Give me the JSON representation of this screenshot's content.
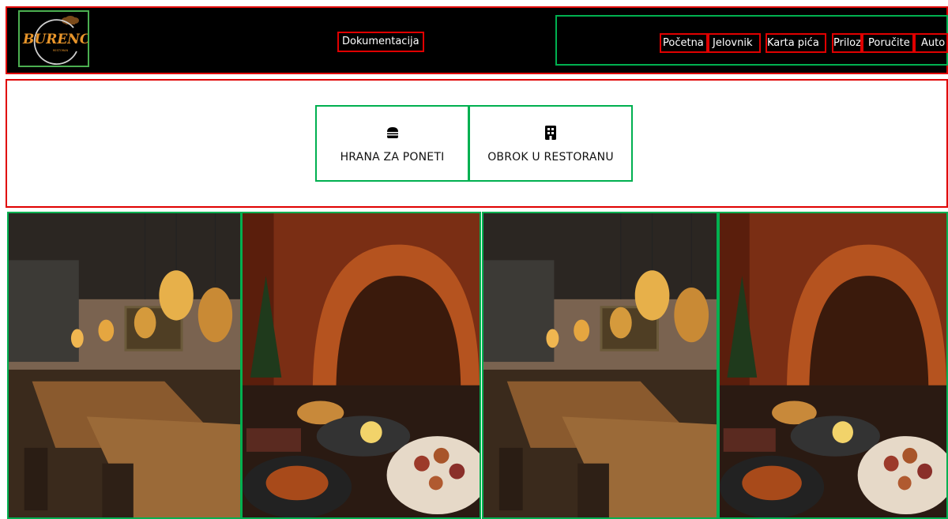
{
  "header": {
    "logo_text": "BURENCE",
    "doc_link": "Dokumentacija",
    "nav": [
      "Početna",
      "Jelovnik",
      "Karta pića",
      "Prilozi",
      "Poručite",
      "Auto"
    ]
  },
  "order_options": [
    {
      "label": "HRANA ZA PONETI",
      "icon": "burger-icon"
    },
    {
      "label": "OBROK U RESTORANU",
      "icon": "building-icon"
    }
  ],
  "gallery": [
    {
      "kind": "restaurant-interior"
    },
    {
      "kind": "food-platter"
    },
    {
      "kind": "restaurant-interior"
    },
    {
      "kind": "food-platter"
    }
  ],
  "colors": {
    "header_bg": "#000000",
    "annotation_red": "#e00000",
    "annotation_green": "#00b050",
    "logo_orange": "#e8952a"
  }
}
